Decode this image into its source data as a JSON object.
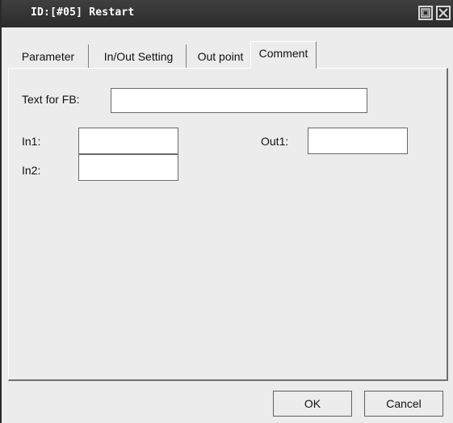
{
  "window": {
    "title": "ID:[#05] Restart"
  },
  "tabs": [
    {
      "label": "Parameter"
    },
    {
      "label": "In/Out Setting"
    },
    {
      "label": "Out point"
    },
    {
      "label": "Comment",
      "active": true
    }
  ],
  "comment": {
    "text_for_fb_label": "Text for FB:",
    "text_for_fb_value": "",
    "in1_label": "In1:",
    "in1_value": "",
    "in2_label": "In2:",
    "in2_value": "",
    "out1_label": "Out1:",
    "out1_value": ""
  },
  "buttons": {
    "ok_label": "OK",
    "cancel_label": "Cancel"
  }
}
